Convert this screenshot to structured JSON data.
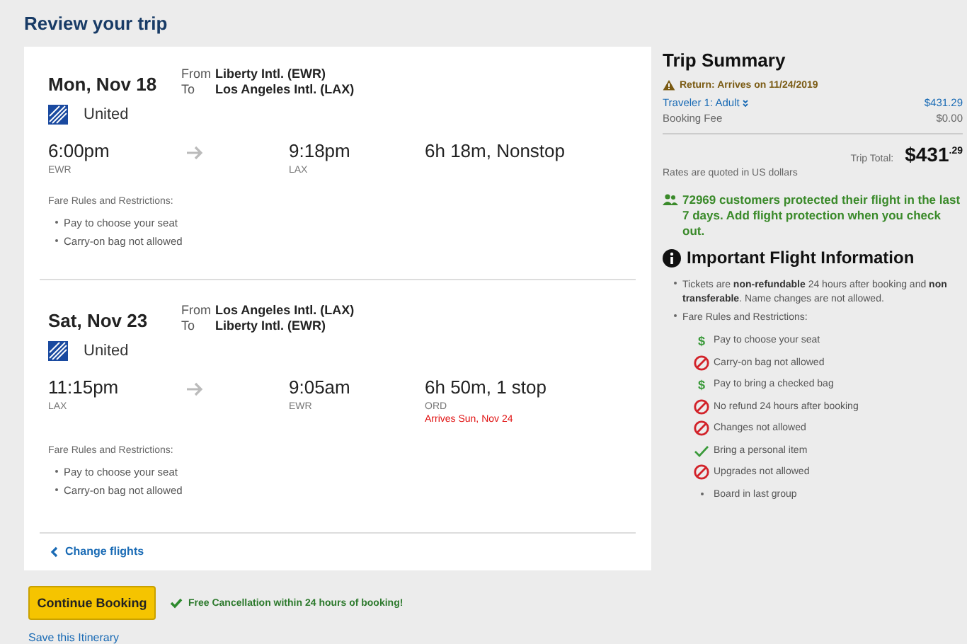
{
  "page_title": "Review your trip",
  "flights": [
    {
      "date": "Mon, Nov 18",
      "from_label": "From",
      "from": "Liberty Intl. (EWR)",
      "to_label": "To",
      "to": "Los Angeles Intl. (LAX)",
      "airline": "United",
      "depart_time": "6:00pm",
      "depart_code": "EWR",
      "arrive_time": "9:18pm",
      "arrive_code": "LAX",
      "duration": "6h 18m, Nonstop",
      "fare_title": "Fare Rules and Restrictions:",
      "rules": [
        "Pay to choose your seat",
        "Carry-on bag not allowed"
      ]
    },
    {
      "date": "Sat, Nov 23",
      "from_label": "From",
      "from": "Los Angeles Intl. (LAX)",
      "to_label": "To",
      "to": "Liberty Intl. (EWR)",
      "airline": "United",
      "depart_time": "11:15pm",
      "depart_code": "LAX",
      "arrive_time": "9:05am",
      "arrive_code": "EWR",
      "duration": "6h 50m, 1 stop",
      "stop_code": "ORD",
      "arrival_note": "Arrives Sun, Nov 24",
      "fare_title": "Fare Rules and Restrictions:",
      "rules": [
        "Pay to choose your seat",
        "Carry-on bag not allowed"
      ]
    }
  ],
  "change_flights": "Change flights",
  "continue_button": "Continue Booking",
  "free_cancellation": "Free Cancellation within 24 hours of booking!",
  "save_itinerary": "Save this Itinerary",
  "summary": {
    "title": "Trip Summary",
    "warning": "Return: Arrives on 11/24/2019",
    "lines": [
      {
        "label": "Traveler 1: Adult",
        "amount": "$431.29",
        "kind": "link"
      },
      {
        "label": "Booking Fee",
        "amount": "$0.00",
        "kind": "plain"
      }
    ],
    "total_label": "Trip Total:",
    "total": "$431$^{.29}$",
    "rates_note": "Rates are quoted in US dollars",
    "protection": "72969 customers protected their flight in the last 7 days. Add flight protection when you check out."
  },
  "important": {
    "title": "Important Flight Information",
    "tickets": "Tickets are **non-refundable** 24 hours after booking and **non transferable**. Name changes are not allowed.",
    "fare_title": "Fare Rules and Restrictions:",
    "rules": [
      {
        "text": "Pay to choose your seat",
        "kind": "pay",
        "icon": "$"
      },
      {
        "text": "Carry-on bag not allowed",
        "kind": "no"
      },
      {
        "text": "Pay to bring a checked bag",
        "kind": "pay",
        "icon": "$"
      },
      {
        "text": "No refund 24 hours after booking",
        "kind": "no"
      },
      {
        "text": "Changes not allowed",
        "kind": "no"
      },
      {
        "text": "Bring a personal item",
        "kind": "ok"
      },
      {
        "text": "Upgrades not allowed",
        "kind": "no"
      },
      {
        "text": "Board in last group",
        "kind": "plain"
      }
    ]
  }
}
